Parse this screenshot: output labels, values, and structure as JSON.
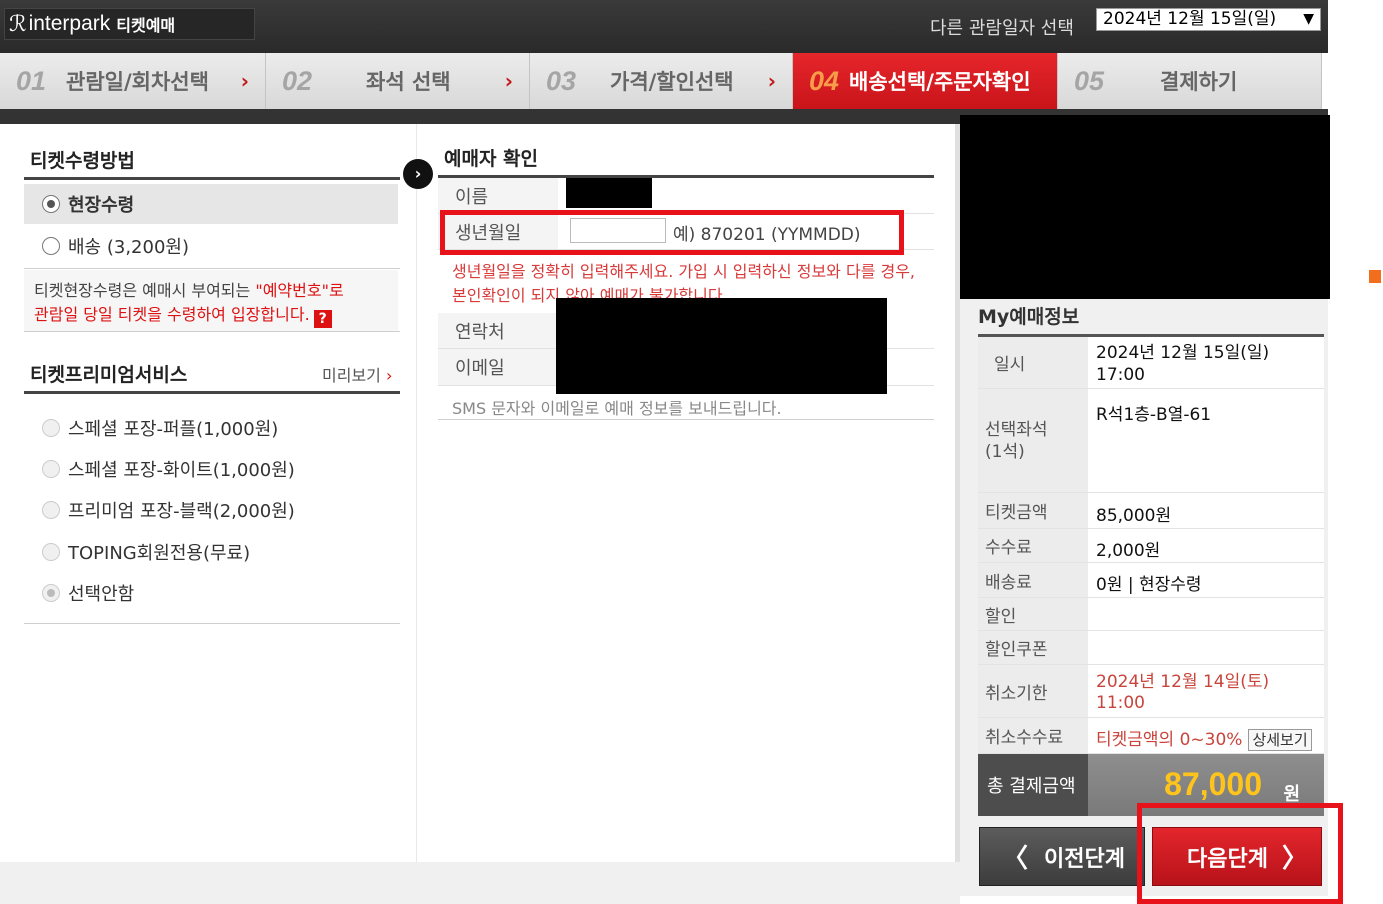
{
  "header": {
    "logo_mark": "ℛ",
    "brand": "interpark",
    "brand_sub": "티켓예매",
    "date_label": "다른 관람일자 선택",
    "date_selected": "2024년 12월 15일(일)"
  },
  "steps": [
    {
      "num": "01",
      "label": "관람일/회차선택",
      "active": false
    },
    {
      "num": "02",
      "label": "좌석 선택",
      "active": false
    },
    {
      "num": "03",
      "label": "가격/할인선택",
      "active": false
    },
    {
      "num": "04",
      "label": "배송선택/주문자확인",
      "active": true
    },
    {
      "num": "05",
      "label": "결제하기",
      "active": false
    }
  ],
  "receipt": {
    "title": "티켓수령방법",
    "options": [
      {
        "label": "현장수령",
        "checked": true
      },
      {
        "label": "배송 (3,200원)",
        "checked": false
      }
    ],
    "note_prefix": "티켓현장수령은 예매시 부여되는 ",
    "note_highlight": "\"예약번호\"로",
    "note_suffix": "관람일 당일 티켓을 수령하여 입장합니다.",
    "help_icon": "?"
  },
  "premium": {
    "title": "티켓프리미엄서비스",
    "preview_label": "미리보기",
    "preview_chevron": "›",
    "options": [
      {
        "label": "스페셜 포장-퍼플(1,000원)"
      },
      {
        "label": "스페셜 포장-화이트(1,000원)"
      },
      {
        "label": "프리미엄 포장-블랙(2,000원)"
      },
      {
        "label": "TOPING회원전용(무료)"
      },
      {
        "label": "선택안함"
      }
    ]
  },
  "booker": {
    "title": "예매자 확인",
    "name_label": "이름",
    "birth_label": "생년월일",
    "birth_value": "",
    "birth_example": "예) 870201 (YYMMDD)",
    "birth_warning": "생년월일을 정확히 입력해주세요. 가입 시 입력하신 정보와 다를 경우, 본인확인이 되지 않아 예매가 불가합니다.",
    "contact_label": "연락처",
    "email_label": "이메일",
    "sms_note": "SMS 문자와 이메일로 예매 정보를 보내드립니다."
  },
  "my_info": {
    "title": "My예매정보",
    "rows": {
      "datetime_label": "일시",
      "datetime_value": "2024년 12월 15일(일)",
      "datetime_time": "17:00",
      "seat_label": "선택좌석",
      "seat_count": "(1석)",
      "seat_value": "R석1층-B열-61",
      "ticket_label": "티켓금액",
      "ticket_value": "85,000원",
      "fee_label": "수수료",
      "fee_value": "2,000원",
      "delivery_label": "배송료",
      "delivery_value": "0원 | 현장수령",
      "discount_label": "할인",
      "coupon_label": "할인쿠폰",
      "cancel_deadline_label": "취소기한",
      "cancel_deadline_value": "2024년 12월 14일(토)",
      "cancel_deadline_time": "11:00",
      "cancel_fee_label": "취소수수료",
      "cancel_fee_value": "티켓금액의 0~30%",
      "detail_button": "상세보기"
    },
    "total_label": "총 결제금액",
    "total_amount": "87,000",
    "total_unit": "원"
  },
  "buttons": {
    "prev": "이전단계",
    "next": "다음단계",
    "prev_chevron": "〈",
    "next_chevron": "〉"
  },
  "colors": {
    "accent_red": "#e8121a",
    "total_yellow": "#ffc41c",
    "warning_red": "#d83a3a"
  }
}
